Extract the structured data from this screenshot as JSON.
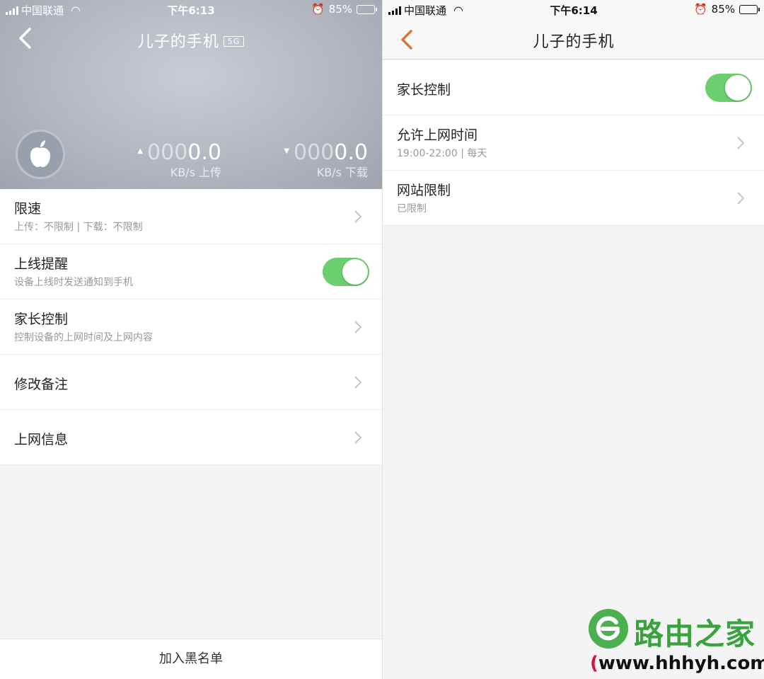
{
  "status_left": {
    "carrier": "中国联通",
    "time": "下午6:13",
    "battery": "85%",
    "battery_level": 0.85
  },
  "status_right": {
    "carrier": "中国联通",
    "time": "下午6:14",
    "battery": "85%",
    "battery_level": 0.85
  },
  "device_screen": {
    "title": "儿子的手机",
    "band_badge": "5G",
    "upload": {
      "dim_digits": "000",
      "value": "0.0",
      "unit": "KB/s 上传"
    },
    "download": {
      "dim_digits": "000",
      "value": "0.0",
      "unit": "KB/s 下载"
    },
    "items": [
      {
        "title": "限速",
        "subtitle": "上传：不限制 | 下载：不限制",
        "control": "chevron"
      },
      {
        "title": "上线提醒",
        "subtitle": "设备上线时发送通知到手机",
        "control": "toggle",
        "toggle_on": true
      },
      {
        "title": "家长控制",
        "subtitle": "控制设备的上网时间及上网内容",
        "control": "chevron"
      },
      {
        "title": "修改备注",
        "control": "chevron"
      },
      {
        "title": "上网信息",
        "control": "chevron"
      }
    ],
    "bottom_action": "加入黑名单"
  },
  "parental_screen": {
    "title": "儿子的手机",
    "items": [
      {
        "title": "家长控制",
        "control": "toggle",
        "toggle_on": true
      },
      {
        "title": "允许上网时间",
        "subtitle": "19:00-22:00 | 每天",
        "control": "chevron"
      },
      {
        "title": "网站限制",
        "subtitle": "已限制",
        "control": "chevron"
      }
    ]
  },
  "watermark": {
    "name": "路由之家",
    "url_open": "(",
    "url": "www.hhhyh.com",
    "url_close": ")"
  },
  "colors": {
    "toggle_on": "#6ccf6f",
    "back_accent": "#d2783e",
    "watermark_green": "#3aa23e",
    "watermark_paren": "#d0163a"
  },
  "icons": {
    "back": "chevron-left-icon",
    "row_arrow": "chevron-right-icon",
    "avatar": "apple-logo-icon",
    "watermark_logo": "watermark-e-logo"
  }
}
